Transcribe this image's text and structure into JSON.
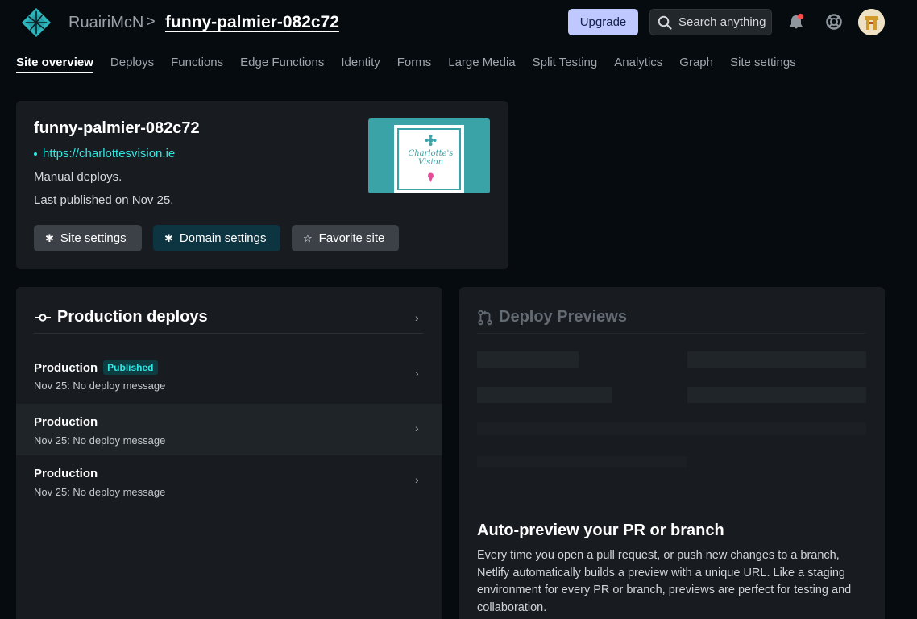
{
  "header": {
    "team": "RuairiMcN",
    "separator": ">",
    "site": "funny-palmier-082c72",
    "upgrade_label": "Upgrade",
    "search_label": "Search anything"
  },
  "tabs": [
    {
      "label": "Site overview",
      "active": true
    },
    {
      "label": "Deploys"
    },
    {
      "label": "Functions"
    },
    {
      "label": "Edge Functions"
    },
    {
      "label": "Identity"
    },
    {
      "label": "Forms"
    },
    {
      "label": "Large Media"
    },
    {
      "label": "Split Testing"
    },
    {
      "label": "Analytics"
    },
    {
      "label": "Graph"
    },
    {
      "label": "Site settings"
    }
  ],
  "site_card": {
    "name": "funny-palmier-082c72",
    "url": "https://charlottesvision.ie",
    "deploy_mode": "Manual deploys.",
    "last_published": "Last published on Nov 25.",
    "thumbnail_text": "Charlotte's Vision",
    "buttons": {
      "site_settings": "Site settings",
      "domain_settings": "Domain settings",
      "favorite": "Favorite site"
    }
  },
  "production": {
    "title": "Production deploys",
    "deploys": [
      {
        "title": "Production",
        "badge": "Published",
        "subtitle": "Nov 25: No deploy message"
      },
      {
        "title": "Production",
        "subtitle": "Nov 25: No deploy message"
      },
      {
        "title": "Production",
        "subtitle": "Nov 25: No deploy message"
      }
    ]
  },
  "previews": {
    "title": "Deploy Previews",
    "cta_title": "Auto-preview your PR or branch",
    "cta_body": "Every time you open a pull request, or push new changes to a branch, Netlify automatically builds a preview with a unique URL. Like a staging environment for every PR or branch, previews are perfect for testing and collaboration."
  },
  "colors": {
    "accent_teal": "#32e6e2",
    "upgrade_bg": "#bfc8ff",
    "page_bg": "#060b10",
    "card_bg": "#181c21",
    "notification_dot": "#ff4d4d"
  },
  "icons": [
    "netlify-logo-icon",
    "search-icon",
    "bell-icon",
    "help-lifebuoy-icon",
    "gear-icon",
    "star-icon",
    "commit-icon",
    "pull-request-icon",
    "chevron-right-icon"
  ]
}
